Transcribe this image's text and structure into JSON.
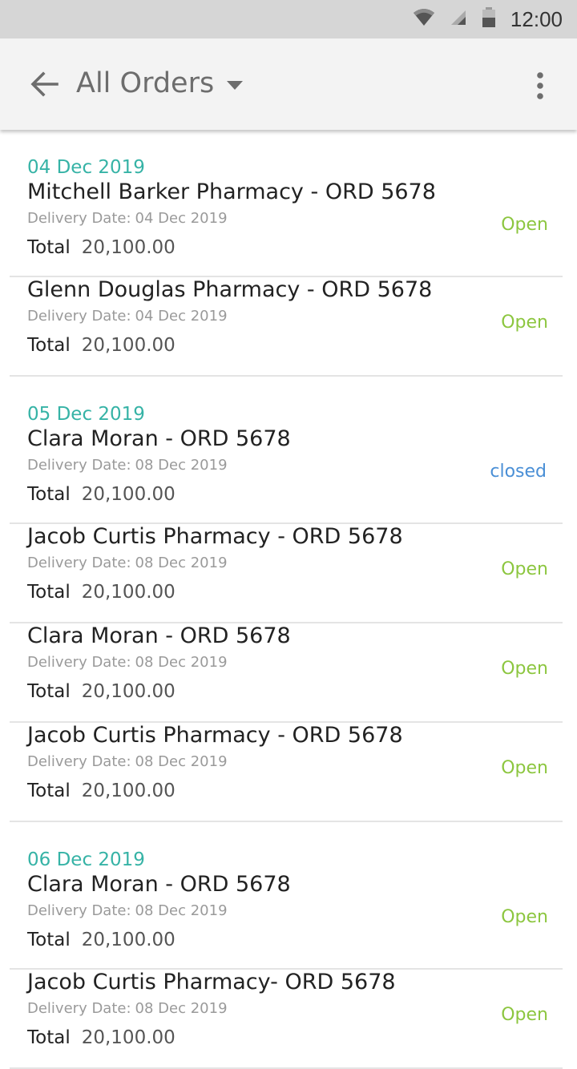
{
  "status_bar": {
    "time": "12:00",
    "icons": [
      "wifi-icon",
      "signal-icon",
      "battery-icon"
    ]
  },
  "app_bar": {
    "title": "All Orders",
    "back_icon": "arrow-left-icon",
    "dropdown_icon": "caret-down-icon",
    "menu_icon": "more-vert-icon"
  },
  "labels": {
    "delivery": "Delivery Date:",
    "total": "Total"
  },
  "colors": {
    "date_header": "#36b3a6",
    "open": "#8cc63f",
    "closed": "#4a8fd6"
  },
  "groups": [
    {
      "date": "04 Dec 2019",
      "orders": [
        {
          "title": "Mitchell Barker Pharmacy - ORD 5678",
          "delivery_date": "04 Dec 2019",
          "total": "20,100.00",
          "status": "Open"
        },
        {
          "title": "Glenn Douglas Pharmacy - ORD 5678",
          "delivery_date": "04 Dec 2019",
          "total": "20,100.00",
          "status": "Open"
        }
      ]
    },
    {
      "date": "05 Dec 2019",
      "orders": [
        {
          "title": "Clara Moran - ORD 5678",
          "delivery_date": "08 Dec 2019",
          "total": "20,100.00",
          "status": "closed"
        },
        {
          "title": "Jacob Curtis Pharmacy - ORD 5678",
          "delivery_date": "08 Dec 2019",
          "total": "20,100.00",
          "status": "Open"
        },
        {
          "title": "Clara Moran - ORD 5678",
          "delivery_date": "08 Dec 2019",
          "total": "20,100.00",
          "status": "Open"
        },
        {
          "title": "Jacob Curtis Pharmacy - ORD 5678",
          "delivery_date": "08 Dec 2019",
          "total": "20,100.00",
          "status": "Open"
        }
      ]
    },
    {
      "date": "06 Dec 2019",
      "orders": [
        {
          "title": "Clara Moran - ORD 5678",
          "delivery_date": "08 Dec 2019",
          "total": "20,100.00",
          "status": "Open"
        },
        {
          "title": "Jacob Curtis Pharmacy- ORD 5678",
          "delivery_date": "08 Dec 2019",
          "total": "20,100.00",
          "status": "Open"
        }
      ]
    }
  ]
}
